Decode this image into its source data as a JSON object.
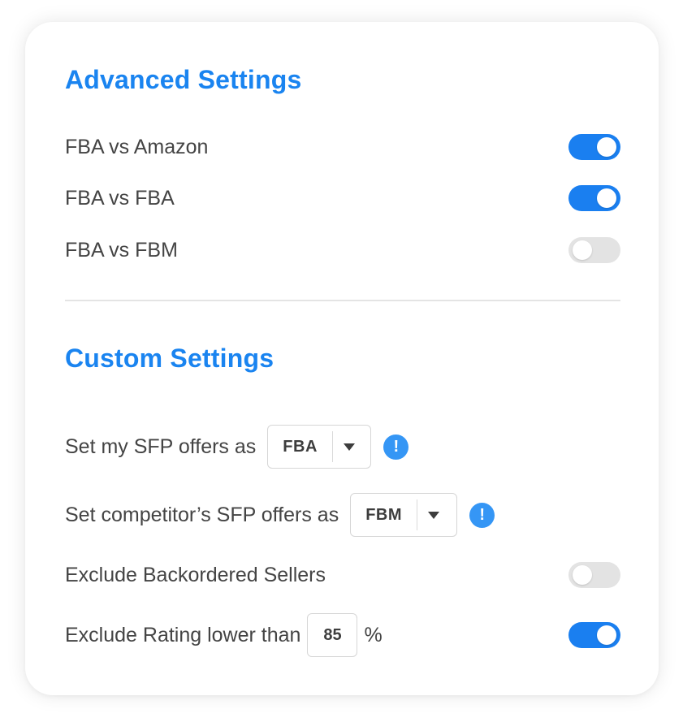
{
  "advanced": {
    "title": "Advanced Settings",
    "items": [
      {
        "label": "FBA vs Amazon",
        "enabled": true
      },
      {
        "label": "FBA vs FBA",
        "enabled": true
      },
      {
        "label": "FBA vs FBM",
        "enabled": false
      }
    ]
  },
  "custom": {
    "title": "Custom Settings",
    "my_sfp": {
      "label": "Set my SFP offers as",
      "value": "FBA",
      "info_icon": "!"
    },
    "competitor_sfp": {
      "label": "Set competitor’s SFP offers as",
      "value": "FBM",
      "info_icon": "!"
    },
    "exclude_backordered": {
      "label": "Exclude Backordered Sellers",
      "enabled": false
    },
    "exclude_rating": {
      "label": "Exclude Rating lower than",
      "value": "85",
      "unit": "%",
      "enabled": true
    }
  },
  "colors": {
    "accent": "#1a84f0",
    "toggle_on": "#1a7ff0",
    "toggle_off": "#e3e3e3",
    "info": "#3596f5"
  },
  "icons": {
    "info": "info-icon",
    "dropdown": "chevron-down-icon"
  }
}
